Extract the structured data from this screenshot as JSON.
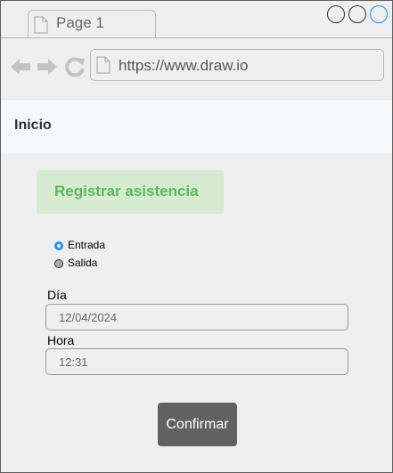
{
  "browser": {
    "tab_title": "Page 1",
    "url": "https://www.draw.io",
    "window_controls": [
      "circle-button",
      "circle-button",
      "circle-button-highlighted"
    ],
    "nav_icons": [
      "back-arrow-icon",
      "forward-arrow-icon",
      "refresh-icon"
    ]
  },
  "header": {
    "title": "Inicio"
  },
  "banner": {
    "title": "Registrar asistencia",
    "color": "#5cb85c",
    "background": "#d5ecd1"
  },
  "attendance_type": {
    "options": [
      {
        "label": "Entrada",
        "checked": true
      },
      {
        "label": "Salida",
        "checked": false
      }
    ],
    "accent": "#1e90ff"
  },
  "form": {
    "day_label": "Día",
    "day_value": "12/04/2024",
    "time_label": "Hora",
    "time_value": "12:31"
  },
  "actions": {
    "confirm_label": "Confirmar",
    "confirm_color": "#616161"
  }
}
